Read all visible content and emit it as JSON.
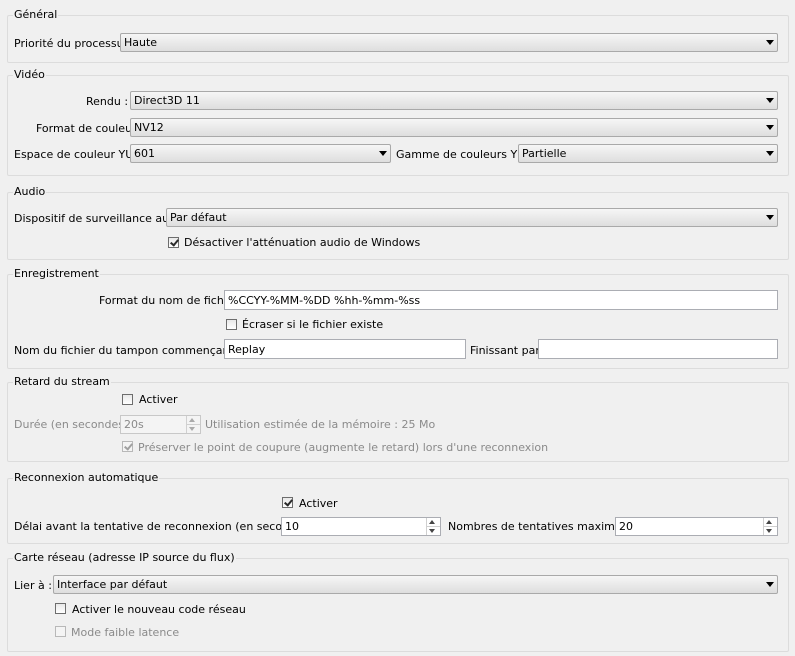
{
  "general": {
    "title": "Général",
    "priority_label": "Priorité du processus",
    "priority_value": "Haute"
  },
  "video": {
    "title": "Vidéo",
    "renderer_label": "Rendu :",
    "renderer_value": "Direct3D 11",
    "color_format_label": "Format de couleur",
    "color_format_value": "NV12",
    "color_space_label": "Espace de couleur YUV",
    "color_space_value": "601",
    "color_range_label": "Gamme de couleurs YUV",
    "color_range_value": "Partielle"
  },
  "audio": {
    "title": "Audio",
    "monitoring_label": "Dispositif de surveillance audio",
    "monitoring_value": "Par défaut",
    "disable_ducking_label": "Désactiver l'atténuation audio de Windows",
    "disable_ducking_checked": true
  },
  "recording": {
    "title": "Enregistrement",
    "filename_format_label": "Format du nom de fichier",
    "filename_format_value": "%CCYY-%MM-%DD %hh-%mm-%ss",
    "overwrite_label": "Écraser si le fichier existe",
    "overwrite_checked": false,
    "replay_prefix_label": "Nom du fichier du tampon commençant par",
    "replay_prefix_value": "Replay",
    "replay_suffix_label": "Finissant par",
    "replay_suffix_value": ""
  },
  "stream_delay": {
    "title": "Retard du stream",
    "enable_label": "Activer",
    "enable_checked": false,
    "duration_label": "Durée (en secondes)",
    "duration_value": "20s",
    "memory_text": "Utilisation estimée de la mémoire : 25 Mo",
    "preserve_label": "Préserver le point de coupure (augmente le retard) lors d'une reconnexion",
    "preserve_checked": true
  },
  "auto_reconnect": {
    "title": "Reconnexion automatique",
    "enable_label": "Activer",
    "enable_checked": true,
    "retry_delay_label": "Délai avant la tentative de reconnexion (en secondes)",
    "retry_delay_value": "10",
    "max_retries_label": "Nombres de tentatives maximales",
    "max_retries_value": "20"
  },
  "network": {
    "title": "Carte réseau (adresse IP source du flux)",
    "bind_label": "Lier à :",
    "bind_value": "Interface par défaut",
    "new_code_label": "Activer le nouveau code réseau",
    "new_code_checked": false,
    "low_latency_label": "Mode faible latence",
    "low_latency_checked": false
  },
  "icons": {
    "dropdown": "chevron-down-icon",
    "spin_up": "arrow-up-icon",
    "spin_down": "arrow-down-icon",
    "checkmark": "check-icon"
  },
  "colors": {
    "background": "#f0f0f0",
    "group_border": "#dcdcdc",
    "disabled_text": "#8a8a8a"
  }
}
